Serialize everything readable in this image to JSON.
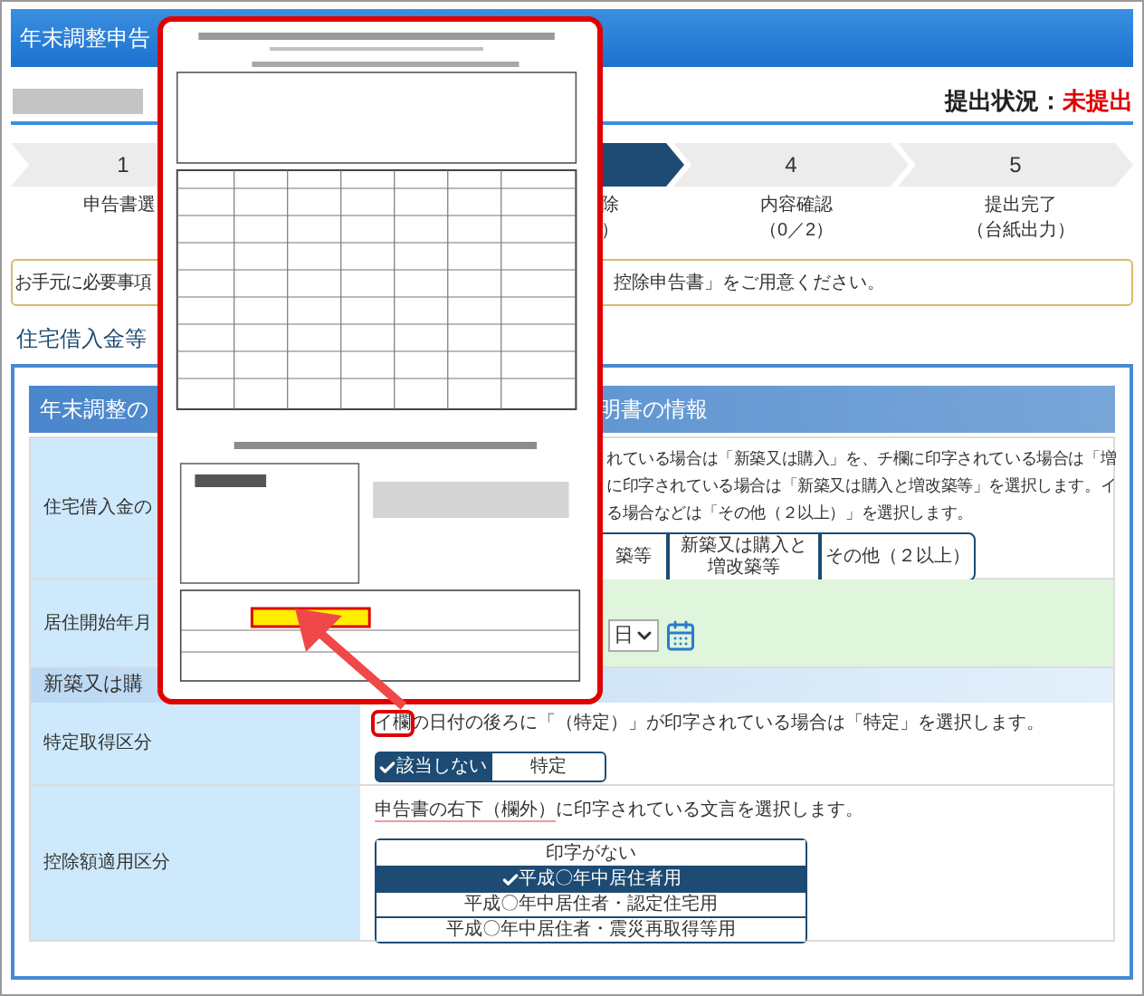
{
  "header": {
    "title": "年末調整申告"
  },
  "status": {
    "label": "提出状況：",
    "value": "未提出"
  },
  "steps": [
    {
      "number": "1",
      "label": "申告書選",
      "selected": false
    },
    {
      "label": "除",
      "sub": "）",
      "selected": true
    },
    {
      "number": "4",
      "label": "内容確認",
      "sub": "（0／2）",
      "selected": false
    },
    {
      "number": "5",
      "label": "提出完了",
      "sub": "（台紙出力）",
      "selected": false
    }
  ],
  "notice": [
    "お手元に必要事項",
    "控除申告書」をご用意ください。"
  ],
  "section_title": "住宅借入金等",
  "panel_header": [
    "年末調整の",
    "明書の情報"
  ],
  "loan_type": {
    "label": "住宅借入金の",
    "lines": [
      "れている場合は「新築又は購入」を、チ欄に印字されている場合は「増",
      "に印字されている場合は「新築又は購入と増改築等」を選択します。イ",
      "る場合などは「その他（２以上）」を選択します。"
    ],
    "options": [
      {
        "label": "築等",
        "selected": false
      },
      {
        "label": "新築又は購入と増改築等",
        "selected": false
      },
      {
        "label": "その他（２以上）",
        "selected": false
      }
    ]
  },
  "move_in": {
    "label": "居住開始年月",
    "select_value": "日"
  },
  "subheader": "新築又は購",
  "specific": {
    "label": "特定取得区分",
    "hint_mark": "イ欄",
    "hint": "の日付の後ろに「（特定）」が印字されている場合は「特定」を選択します。",
    "options": [
      {
        "label": "該当しない",
        "selected": true
      },
      {
        "label": "特定",
        "selected": false
      }
    ]
  },
  "deduction": {
    "label": "控除額適用区分",
    "hint_mark": "申告書の右下（欄外）",
    "hint": "に印字されている文言を選択します。",
    "options": [
      {
        "label": "印字がない",
        "selected": false
      },
      {
        "label": "平成〇年中居住者用",
        "selected": true
      },
      {
        "label": "平成〇年中居住者・認定住宅用",
        "selected": false
      },
      {
        "label": "平成〇年中居住者・震災再取得等用",
        "selected": false
      }
    ]
  }
}
